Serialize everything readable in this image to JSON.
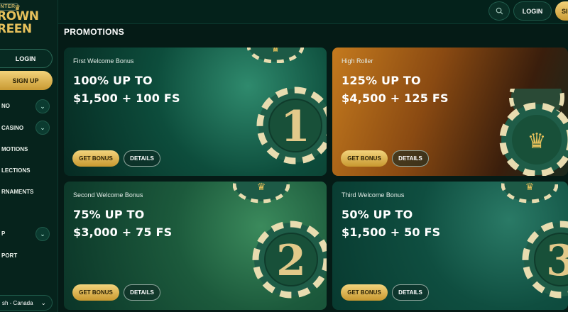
{
  "sidebar": {
    "logo_badge": "WINTER",
    "logo_line1": "ROWN",
    "logo_line2": "REEN",
    "login_label": "LOGIN",
    "signup_label": "SIGN UP",
    "nav": [
      {
        "label": "NO",
        "has_chevron": true
      },
      {
        "label": "CASINO",
        "has_chevron": true
      },
      {
        "label": "MOTIONS",
        "has_chevron": false
      },
      {
        "label": "LECTIONS",
        "has_chevron": false
      },
      {
        "label": "RNAMENTS",
        "has_chevron": false
      },
      {
        "label": "P",
        "has_chevron": true
      },
      {
        "label": "PORT",
        "has_chevron": false
      }
    ],
    "language": "sh - Canada"
  },
  "topbar": {
    "login_label": "LOGIN",
    "signup_label": "SIG"
  },
  "page": {
    "title": "PROMOTIONS"
  },
  "promos": [
    {
      "subtitle": "First Welcome Bonus",
      "line1": "100% UP TO",
      "line2": "$1,500 + 100 FS",
      "chip_number": "1",
      "primary": "GET BONUS",
      "secondary": "DETAILS"
    },
    {
      "subtitle": "High Roller",
      "line1": "125% UP TO",
      "line2": "$4,500 + 125 FS",
      "chip_number": "",
      "primary": "GET BONUS",
      "secondary": "DETAILS"
    },
    {
      "subtitle": "Second Welcome Bonus",
      "line1": "75% UP TO",
      "line2": "$3,000 + 75 FS",
      "chip_number": "2",
      "primary": "GET BONUS",
      "secondary": "DETAILS"
    },
    {
      "subtitle": "Third Welcome Bonus",
      "line1": "50% UP TO",
      "line2": "$1,500 + 50 FS",
      "chip_number": "3",
      "primary": "GET BONUS",
      "secondary": "DETAILS"
    }
  ],
  "colors": {
    "gold": "#e6c05b",
    "background": "#051b16",
    "card_green": "#0d4d3c",
    "card_orange": "#8a4a12"
  }
}
